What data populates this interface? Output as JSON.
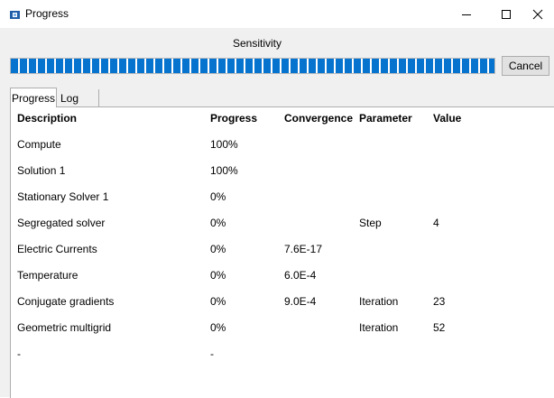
{
  "window": {
    "title": "Progress",
    "app_icon": "app-icon",
    "controls": {
      "minimize": "minimize-icon",
      "maximize": "maximize-icon",
      "close": "close-icon"
    }
  },
  "operation_label": "Sensitivity",
  "progress": {
    "fraction": 1.0,
    "fill_color": "#0673cf"
  },
  "cancel_label": "Cancel",
  "tabs": [
    {
      "label": "Progress",
      "selected": true
    },
    {
      "label": "Log",
      "selected": false
    }
  ],
  "table": {
    "headers": [
      "Description",
      "Progress",
      "Convergence",
      "Parameter",
      "Value"
    ],
    "rows": [
      [
        "Compute",
        "100%",
        "",
        "",
        ""
      ],
      [
        "Solution 1",
        "100%",
        "",
        "",
        ""
      ],
      [
        "Stationary Solver 1",
        "0%",
        "",
        "",
        ""
      ],
      [
        "Segregated solver",
        "0%",
        "",
        "Step",
        "4"
      ],
      [
        "Electric Currents",
        "0%",
        "7.6E-17",
        "",
        ""
      ],
      [
        "Temperature",
        "0%",
        "6.0E-4",
        "",
        ""
      ],
      [
        "Conjugate gradients",
        "0%",
        "9.0E-4",
        "Iteration",
        "23"
      ],
      [
        "Geometric multigrid",
        "0%",
        "",
        "Iteration",
        "52"
      ],
      [
        "-",
        "-",
        "",
        "",
        ""
      ]
    ]
  }
}
